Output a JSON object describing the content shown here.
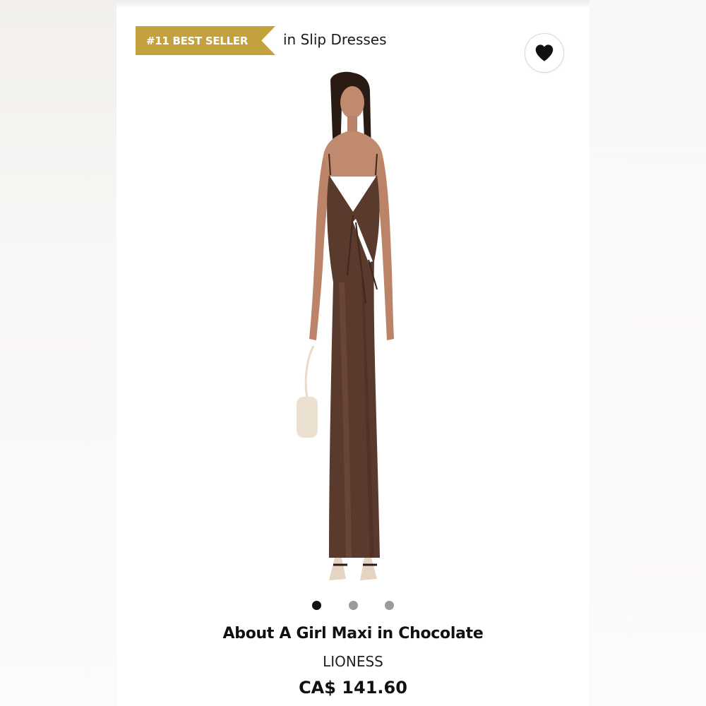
{
  "badge": {
    "rank_label": "#11 BEST SELLER",
    "category_text": "in Slip Dresses",
    "color": "#c4a13f"
  },
  "wishlist": {
    "icon": "heart-icon",
    "state": "filled"
  },
  "product": {
    "image_icon": "product-photo",
    "dress_color": "#5b3a2e",
    "carousel": {
      "count": 3,
      "active_index": 0
    },
    "title": "About A Girl Maxi in Chocolate",
    "brand": "LIONESS",
    "price": "CA$ 141.60"
  }
}
